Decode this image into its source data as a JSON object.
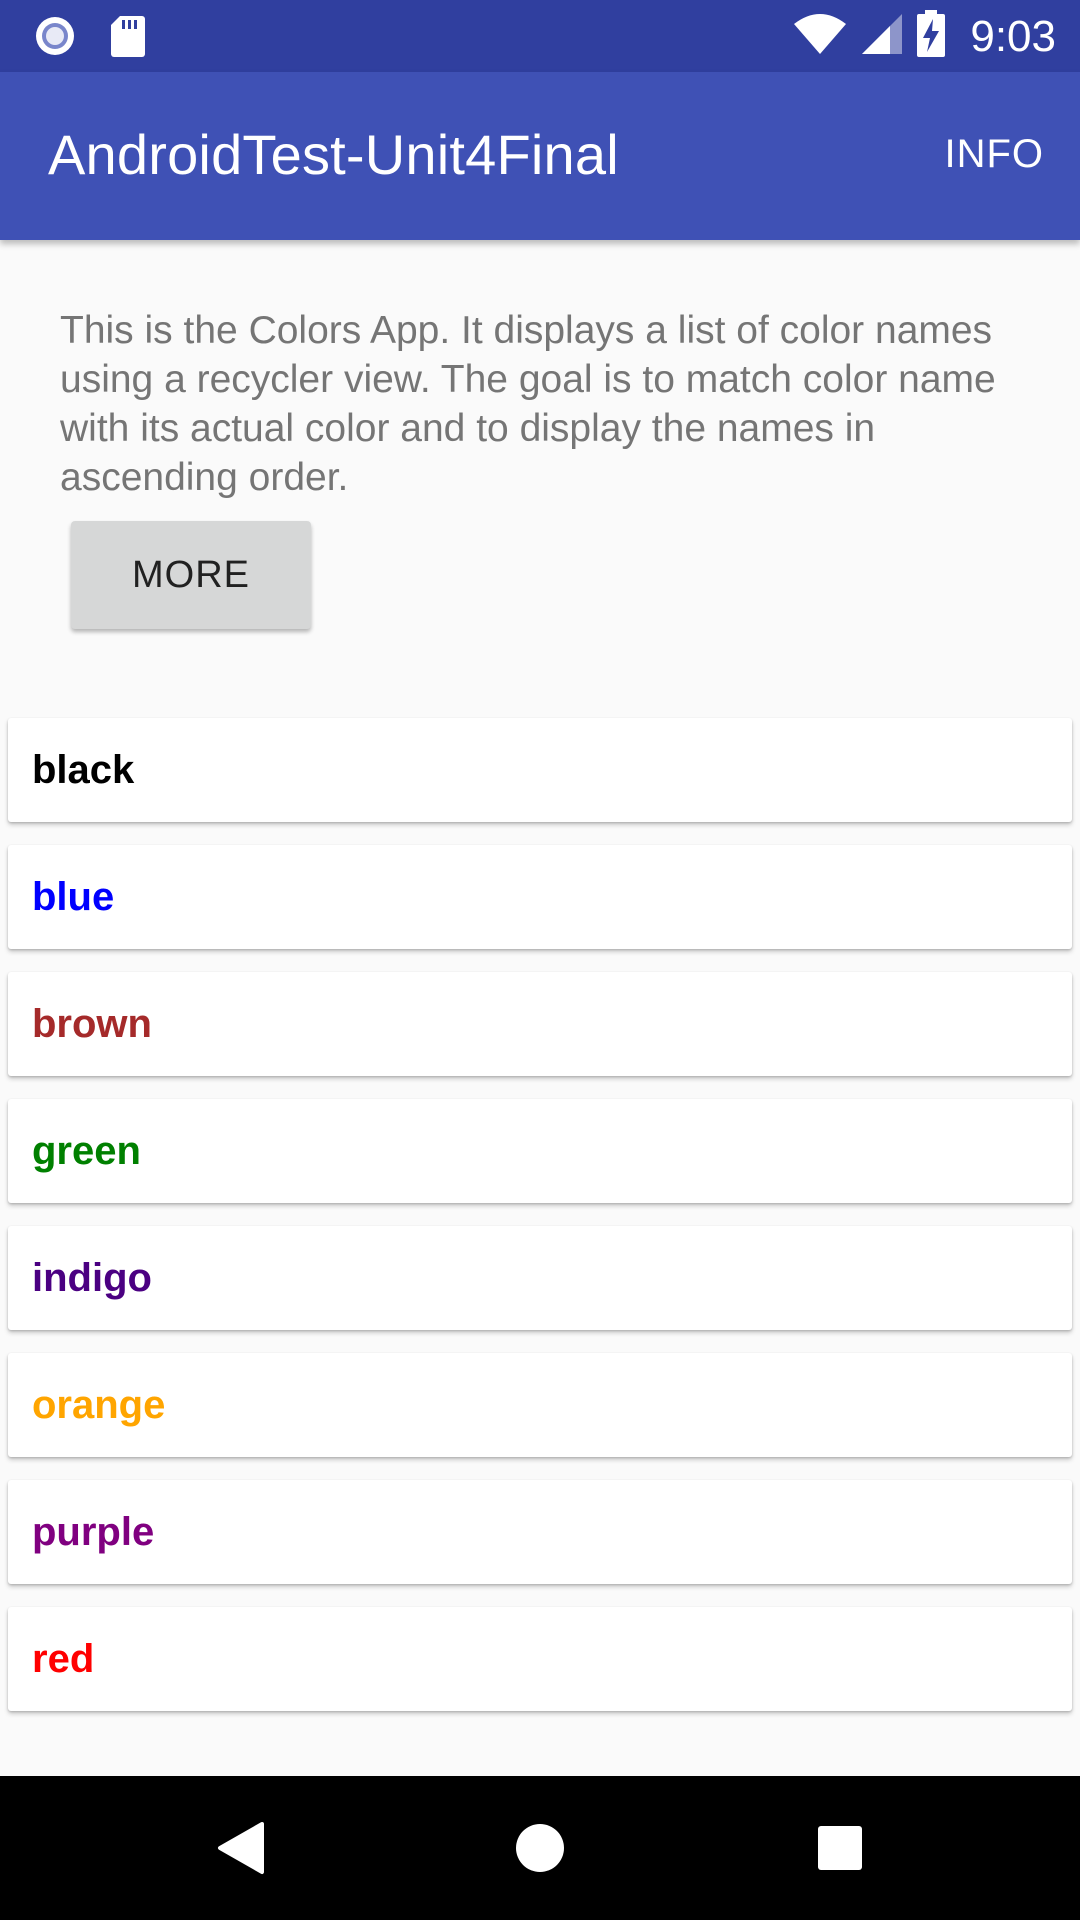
{
  "status_bar": {
    "time": "9:03",
    "icons": [
      "notification-dot-icon",
      "sd-card-icon",
      "wifi-icon",
      "cell-signal-icon",
      "battery-charging-icon"
    ]
  },
  "app_bar": {
    "title": "AndroidTest-Unit4Final",
    "action_label": "INFO"
  },
  "intro": {
    "text": "This is the Colors App. It displays a list of color names using a recycler view. The goal is to match color name with its actual color and to display the names in ascending order.",
    "button_label": "MORE"
  },
  "colors": [
    {
      "name": "black",
      "hex": "#000000"
    },
    {
      "name": "blue",
      "hex": "#0000ff"
    },
    {
      "name": "brown",
      "hex": "#a52a2a"
    },
    {
      "name": "green",
      "hex": "#008000"
    },
    {
      "name": "indigo",
      "hex": "#4b0082"
    },
    {
      "name": "orange",
      "hex": "#ffa500"
    },
    {
      "name": "purple",
      "hex": "#800080"
    },
    {
      "name": "red",
      "hex": "#ff0000"
    }
  ],
  "nav_bar": {
    "icons": [
      "back-icon",
      "home-icon",
      "recents-icon"
    ]
  }
}
